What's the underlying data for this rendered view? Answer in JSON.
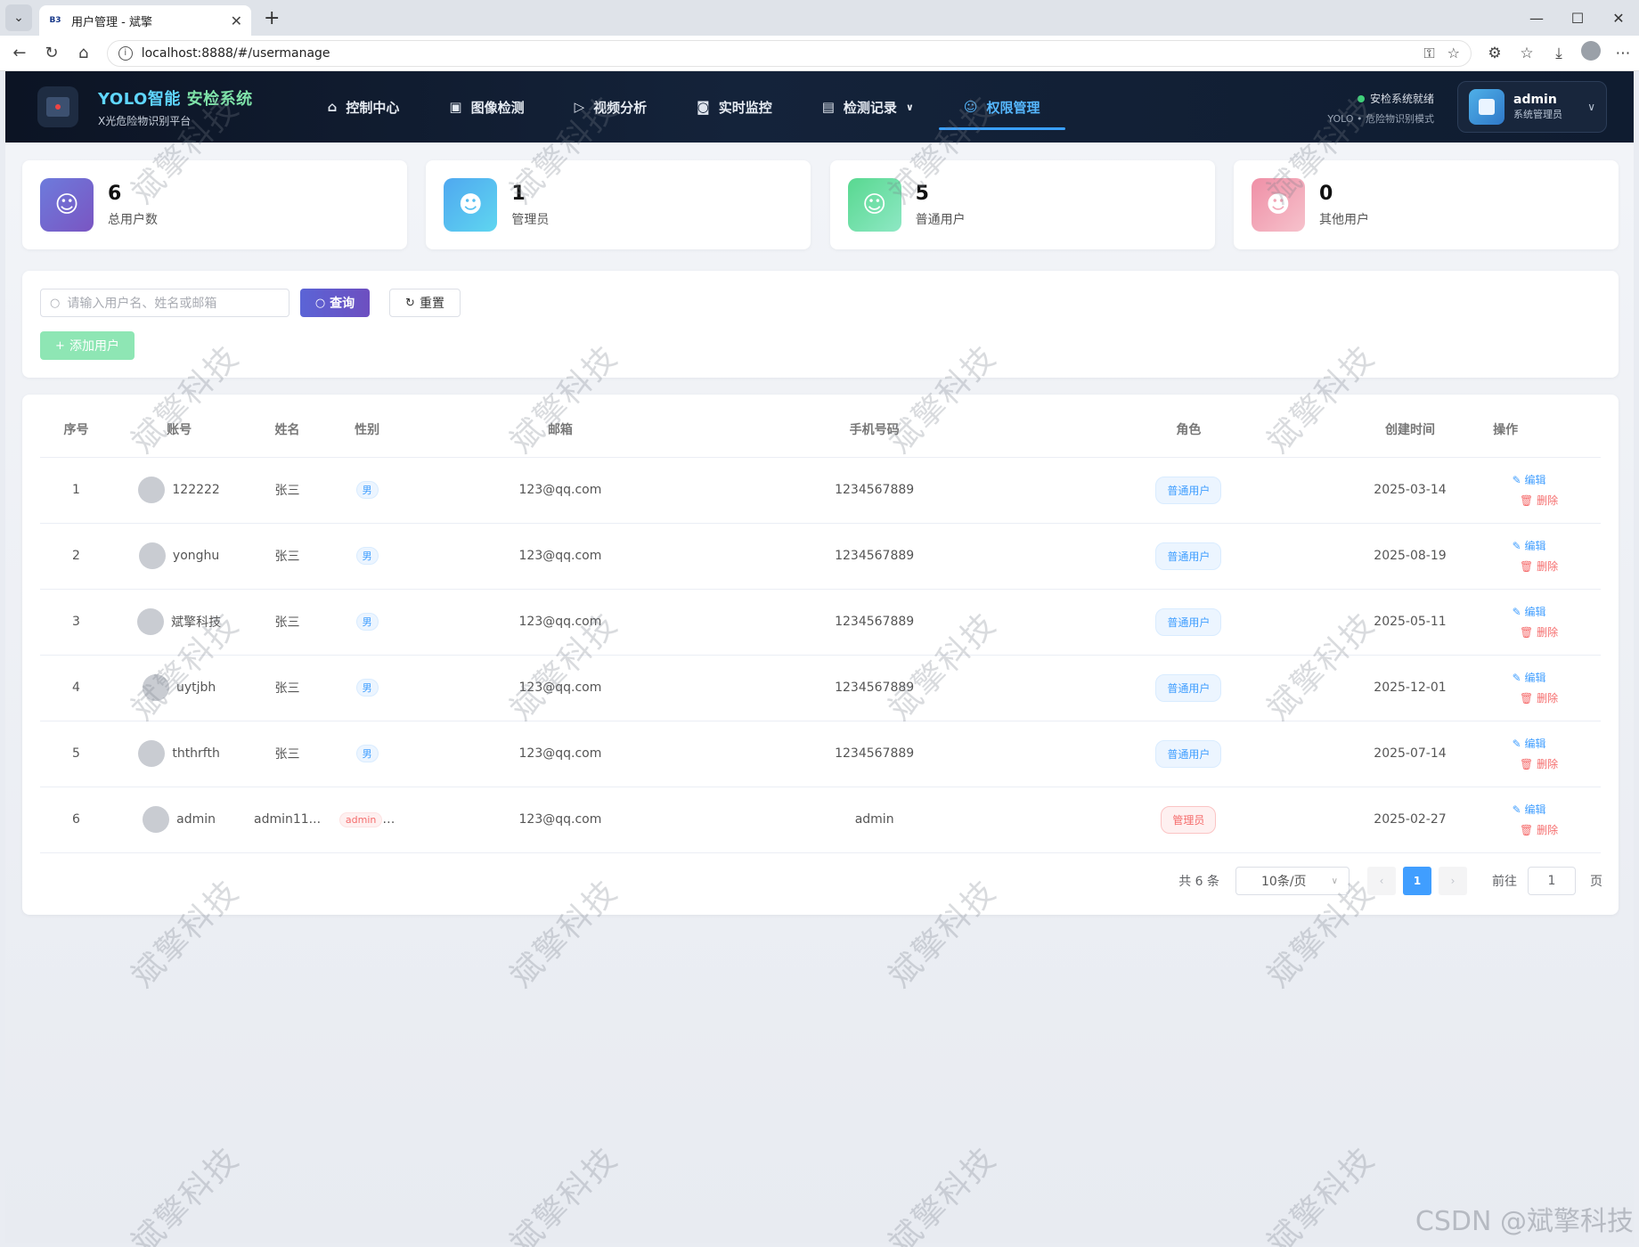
{
  "browser": {
    "tab_title": "用户管理 - 斌擎",
    "favicon_text": "B3",
    "url": "localhost:8888/#/usermanage"
  },
  "header": {
    "brand_yolo": "YOLO智能",
    "brand_rest": "安检系统",
    "subtitle": "X光危险物识别平台",
    "nav": [
      {
        "label": "控制中心",
        "icon": "home-icon"
      },
      {
        "label": "图像检测",
        "icon": "image-icon"
      },
      {
        "label": "视频分析",
        "icon": "play-icon"
      },
      {
        "label": "实时监控",
        "icon": "camera-icon"
      },
      {
        "label": "检测记录",
        "icon": "document-icon"
      },
      {
        "label": "权限管理",
        "icon": "user-icon"
      }
    ],
    "status_line1": "安检系统就绪",
    "status_line2": "YOLO • 危险物识别模式",
    "user_name": "admin",
    "user_role": "系统管理员"
  },
  "stats": [
    {
      "value": "6",
      "label": "总用户数",
      "color": "#6d7bdc"
    },
    {
      "value": "1",
      "label": "管理员",
      "color": "#4fa8f0"
    },
    {
      "value": "5",
      "label": "普通用户",
      "color": "#58d890"
    },
    {
      "value": "0",
      "label": "其他用户",
      "color": "#ef8fa6"
    }
  ],
  "search": {
    "placeholder": "请输入用户名、姓名或邮箱",
    "query_label": "查询",
    "reset_label": "重置",
    "add_label": "添加用户"
  },
  "table": {
    "headers": [
      "序号",
      "账号",
      "姓名",
      "性别",
      "邮箱",
      "手机号码",
      "角色",
      "创建时间",
      "操作"
    ],
    "edit_label": "编辑",
    "delete_label": "删除",
    "rows": [
      {
        "no": "1",
        "account": "122222",
        "name": "张三",
        "gender": "男",
        "email": "123@qq.com",
        "phone": "1234567889",
        "role": "普通用户",
        "created": "2025-03-14"
      },
      {
        "no": "2",
        "account": "yonghu",
        "name": "张三",
        "gender": "男",
        "email": "123@qq.com",
        "phone": "1234567889",
        "role": "普通用户",
        "created": "2025-08-19"
      },
      {
        "no": "3",
        "account": "斌擎科技",
        "name": "张三",
        "gender": "男",
        "email": "123@qq.com",
        "phone": "1234567889",
        "role": "普通用户",
        "created": "2025-05-11"
      },
      {
        "no": "4",
        "account": "uytjbh",
        "name": "张三",
        "gender": "男",
        "email": "123@qq.com",
        "phone": "1234567889",
        "role": "普通用户",
        "created": "2025-12-01"
      },
      {
        "no": "5",
        "account": "ththrfth",
        "name": "张三",
        "gender": "男",
        "email": "123@qq.com",
        "phone": "1234567889",
        "role": "普通用户",
        "created": "2025-07-14"
      },
      {
        "no": "6",
        "account": "admin",
        "name": "admin11...",
        "gender": "admin",
        "email": "123@qq.com",
        "phone": "admin",
        "role": "管理员",
        "created": "2025-02-27"
      }
    ]
  },
  "pagination": {
    "total": "共 6 条",
    "page_size": "10条/页",
    "current": "1",
    "goto_label": "前往",
    "goto_value": "1",
    "page_suffix": "页"
  },
  "watermark": "斌擎科技",
  "csdn": "CSDN @斌擎科技"
}
